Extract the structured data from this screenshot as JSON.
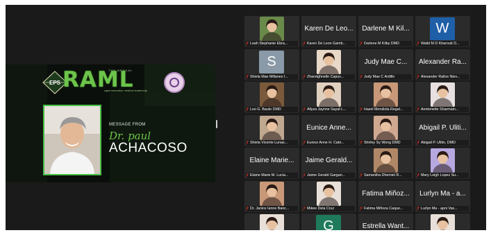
{
  "shared_screen": {
    "event_small": "THE ANNUAL",
    "event_big": "RAML",
    "event_tagline": "rajan education medical leadership",
    "logo_left_text": "EPS",
    "message_from": "MESSAGE FROM",
    "speaker_prefix": "Dr. paul",
    "speaker_name": "ACHACOSO"
  },
  "participants": [
    {
      "type": "photo",
      "big": "",
      "name": "Leah Stephanie Ebra...",
      "color": "#6a8a4a"
    },
    {
      "type": "text",
      "big": "Karen De Leo...",
      "name": "Karen De Leon Gamb..."
    },
    {
      "type": "text",
      "big": "Darlene M Kil...",
      "name": "Darlene M Kilby DMD"
    },
    {
      "type": "letter",
      "letter": "W",
      "bg": "#1f5fa8",
      "big": "",
      "name": "Walid M D Kharoub D..."
    },
    {
      "type": "letter",
      "letter": "S",
      "bg": "#8a9aa8",
      "big": "",
      "name": "Shiela Mae Millanes I..."
    },
    {
      "type": "photo",
      "big": "",
      "name": "Zhareighnelle Capus...",
      "color": "#e8d8c8"
    },
    {
      "type": "text",
      "big": "Judy Mae C...",
      "name": "Judy Mae C Ardillo"
    },
    {
      "type": "text",
      "big": "Alexander Ra...",
      "name": "Alexander Rallos Niev..."
    },
    {
      "type": "photo",
      "big": "",
      "name": "Leo G. Bauto DMD",
      "color": "#7a5a3a"
    },
    {
      "type": "photo",
      "big": "",
      "name": "Allyza Jaynne Sayat L...",
      "color": "#e0d0c0"
    },
    {
      "type": "photo",
      "big": "",
      "name": "Hazel Mendiola Regal...",
      "color": "#c89878"
    },
    {
      "type": "photo",
      "big": "",
      "name": "Anntonette Sharmain...",
      "color": "#e8e0e0"
    },
    {
      "type": "photo",
      "big": "",
      "name": "Shiela Vicente Lunas...",
      "color": "#c0a890"
    },
    {
      "type": "text",
      "big": "Eunice Anne...",
      "name": "Eunice Anne H. Cabr..."
    },
    {
      "type": "photo",
      "big": "",
      "name": "Shirley Sy Wong DMD",
      "color": "#d0a890"
    },
    {
      "type": "text",
      "big": "Abigail P. Uliti...",
      "name": "Abigail P. Ulitin, DMD"
    },
    {
      "type": "text",
      "big": "Elaine Marie...",
      "name": "Elaine Marie M. Lucia..."
    },
    {
      "type": "text",
      "big": "Jaime Gerald...",
      "name": "Jaime Gerald Gargan..."
    },
    {
      "type": "photo",
      "big": "",
      "name": "Samantha Dhemiel R...",
      "color": "#b08868"
    },
    {
      "type": "photo",
      "big": "",
      "name": "Mary Leigh Lopez Su...",
      "color": "#b8a8e0"
    },
    {
      "type": "photo",
      "big": "",
      "name": "Dr. Janice Ianne Banc...",
      "color": "#c89878"
    },
    {
      "type": "photo",
      "big": "",
      "name": "Mikee Dela Cruz",
      "color": "#e8e0d8"
    },
    {
      "type": "text",
      "big": "Fatima Miñoz...",
      "name": "Fatima Miñoza Caque..."
    },
    {
      "type": "text",
      "big": "Lurlyn Ma - a...",
      "name": "Lurlyn Ma - apni Vas..."
    },
    {
      "type": "photo",
      "big": "",
      "name": "",
      "color": "#e8e0d8"
    },
    {
      "type": "letter",
      "letter": "G",
      "bg": "#1e7a5a",
      "big": "",
      "name": ""
    },
    {
      "type": "text",
      "big": "Estrella Want...",
      "name": ""
    },
    {
      "type": "photo",
      "big": "",
      "name": "",
      "color": "#e8e0d8"
    }
  ],
  "colors": {
    "mic_muted": "#e0453a",
    "accent_green": "#6cc44a"
  }
}
